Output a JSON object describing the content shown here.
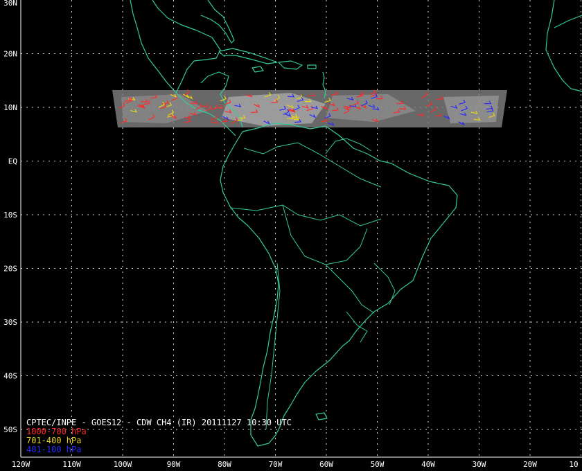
{
  "map": {
    "lon_labels": [
      "120W",
      "110W",
      "100W",
      "90W",
      "80W",
      "70W",
      "60W",
      "50W",
      "40W",
      "30W",
      "20W",
      "10"
    ],
    "lat_labels": [
      "30N",
      "20N",
      "10N",
      "EQ",
      "10S",
      "20S",
      "30S",
      "40S",
      "50S"
    ],
    "lon_range": [
      -120,
      -10
    ],
    "lat_range": [
      -55,
      30
    ],
    "grid": true
  },
  "caption": {
    "title": "CPTEC/INPE - GOES12 - CDW CH4 (IR) 20111127 10:30 UTC",
    "legend": [
      {
        "label": "1000-700 hPa",
        "color": "#ff2a2a"
      },
      {
        "label": "701-400 hPa",
        "color": "#e8d21a"
      },
      {
        "label": "401-100 hPa",
        "color": "#2a2aff"
      }
    ]
  },
  "colors": {
    "background": "#000000",
    "coastline": "#33cc99",
    "grid": "#ffffff",
    "satellite_strip": "#8a8a8a"
  }
}
